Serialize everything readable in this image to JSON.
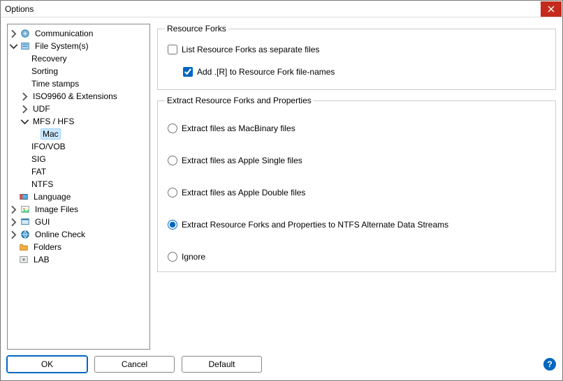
{
  "window": {
    "title": "Options"
  },
  "tree": {
    "communication": "Communication",
    "filesystems": "File System(s)",
    "recovery": "Recovery",
    "sorting": "Sorting",
    "timestamps": "Time stamps",
    "iso": "ISO9960 & Extensions",
    "udf": "UDF",
    "mfs": "MFS / HFS",
    "mac": "Mac",
    "ifovob": "IFO/VOB",
    "sig": "SIG",
    "fat": "FAT",
    "ntfs": "NTFS",
    "language": "Language",
    "imagefiles": "Image Files",
    "gui": "GUI",
    "onlinecheck": "Online Check",
    "folders": "Folders",
    "lab": "LAB"
  },
  "group1": {
    "legend": "Resource Forks",
    "list_separate": {
      "label": "List Resource Forks as separate files",
      "checked": false
    },
    "add_r": {
      "label": "Add .[R] to Resource Fork file-names",
      "checked": true
    }
  },
  "group2": {
    "legend": "Extract Resource Forks and Properties",
    "options": {
      "macbinary": "Extract files as MacBinary files",
      "applesingle": "Extract files as Apple Single files",
      "appledouble": "Extract files as Apple Double files",
      "ntfs_ads": "Extract Resource Forks and Properties to NTFS Alternate Data Streams",
      "ignore": "Ignore"
    },
    "selected": "ntfs_ads"
  },
  "buttons": {
    "ok": "OK",
    "cancel": "Cancel",
    "default": "Default"
  }
}
